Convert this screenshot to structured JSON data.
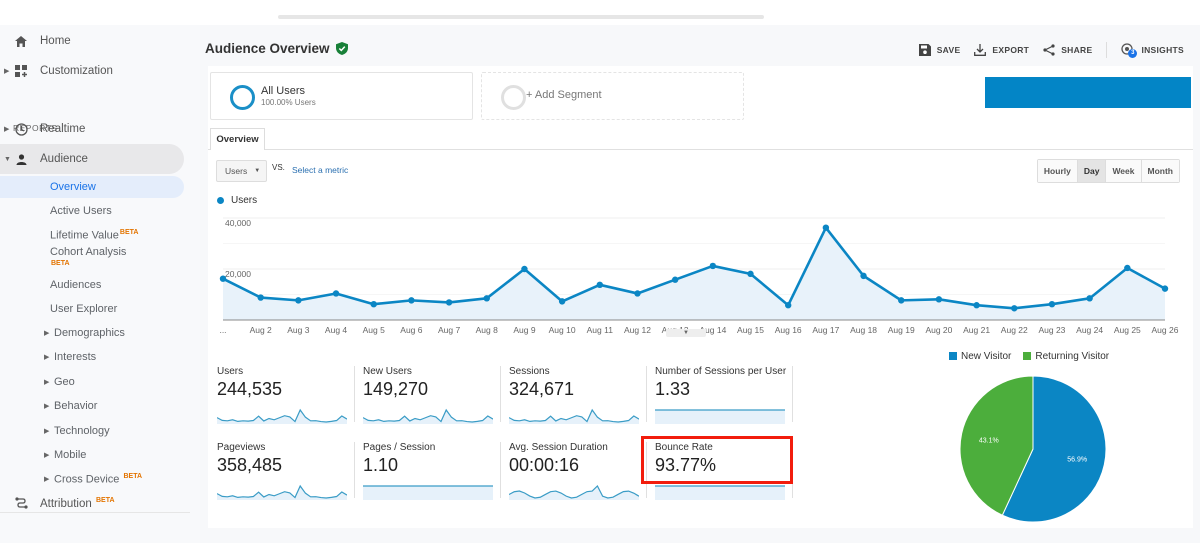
{
  "sidebar": {
    "home": "Home",
    "customization": "Customization",
    "reports_label": "REPORTS",
    "realtime": "Realtime",
    "audience": "Audience",
    "audience_items": [
      {
        "label": "Overview",
        "beta": ""
      },
      {
        "label": "Active Users",
        "beta": ""
      },
      {
        "label": "Lifetime Value",
        "beta": "BETA"
      },
      {
        "label": "Cohort Analysis",
        "beta": "BETA"
      },
      {
        "label": "Audiences",
        "beta": ""
      },
      {
        "label": "User Explorer",
        "beta": ""
      }
    ],
    "audience_groups": [
      {
        "label": "Demographics",
        "beta": ""
      },
      {
        "label": "Interests",
        "beta": ""
      },
      {
        "label": "Geo",
        "beta": ""
      },
      {
        "label": "Behavior",
        "beta": ""
      },
      {
        "label": "Technology",
        "beta": ""
      },
      {
        "label": "Mobile",
        "beta": ""
      },
      {
        "label": "Cross Device",
        "beta": "BETA"
      }
    ],
    "attribution": "Attribution",
    "attribution_beta": "BETA"
  },
  "header": {
    "title": "Audience Overview",
    "actions": {
      "save": "SAVE",
      "export": "EXPORT",
      "share": "SHARE",
      "insights": "INSIGHTS",
      "insights_badge": "3"
    }
  },
  "segments": {
    "all_users": {
      "name": "All Users",
      "sub": "100.00% Users"
    },
    "add_segment": "+ Add Segment"
  },
  "tabs": {
    "overview": "Overview"
  },
  "controls": {
    "metric": "Users",
    "vs": "VS.",
    "select_metric": "Select a metric",
    "granularity": [
      "Hourly",
      "Day",
      "Week",
      "Month"
    ],
    "granularity_selected": "Day"
  },
  "colors": {
    "accent": "#0b86c4",
    "new_visitor": "#0b86c4",
    "returning_visitor": "#4cae3c",
    "highlight": "#f21d0d"
  },
  "chart_data": [
    {
      "type": "area",
      "title": "",
      "legend": [
        "Users"
      ],
      "legend_position": "top-left",
      "x": [
        "...",
        "Aug 2",
        "Aug 3",
        "Aug 4",
        "Aug 5",
        "Aug 6",
        "Aug 7",
        "Aug 8",
        "Aug 9",
        "Aug 10",
        "Aug 11",
        "Aug 12",
        "Aug 13",
        "Aug 14",
        "Aug 15",
        "Aug 16",
        "Aug 17",
        "Aug 18",
        "Aug 19",
        "Aug 20",
        "Aug 21",
        "Aug 22",
        "Aug 23",
        "Aug 24",
        "Aug 25",
        "Aug 26"
      ],
      "series": [
        {
          "name": "Users",
          "values": [
            16200,
            8800,
            7700,
            10400,
            6200,
            7700,
            6900,
            8500,
            20000,
            7300,
            13800,
            10400,
            15800,
            21200,
            18100,
            5800,
            36200,
            17300,
            7700,
            8100,
            5800,
            4600,
            6200,
            8500,
            20400,
            12300
          ]
        }
      ],
      "yticks": [
        "20,000",
        "40,000"
      ],
      "ylim": [
        0,
        40000
      ],
      "grid": true
    },
    {
      "type": "pie",
      "title": "",
      "legend": [
        "New Visitor",
        "Returning Visitor"
      ],
      "legend_position": "top",
      "slices": [
        {
          "label": "New Visitor",
          "value": 56.9,
          "text": "56.9%"
        },
        {
          "label": "Returning Visitor",
          "value": 43.1,
          "text": "43.1%"
        }
      ]
    }
  ],
  "metrics": [
    {
      "label": "Users",
      "value": "244,535",
      "spark": "users"
    },
    {
      "label": "New Users",
      "value": "149,270",
      "spark": "users"
    },
    {
      "label": "Sessions",
      "value": "324,671",
      "spark": "users"
    },
    {
      "label": "Number of Sessions per User",
      "value": "1.33",
      "spark": "flat"
    },
    {
      "label": "Pageviews",
      "value": "358,485",
      "spark": "users"
    },
    {
      "label": "Pages / Session",
      "value": "1.10",
      "spark": "flat"
    },
    {
      "label": "Avg. Session Duration",
      "value": "00:00:16",
      "spark": "duration"
    },
    {
      "label": "Bounce Rate",
      "value": "93.77%",
      "spark": "flat"
    }
  ]
}
